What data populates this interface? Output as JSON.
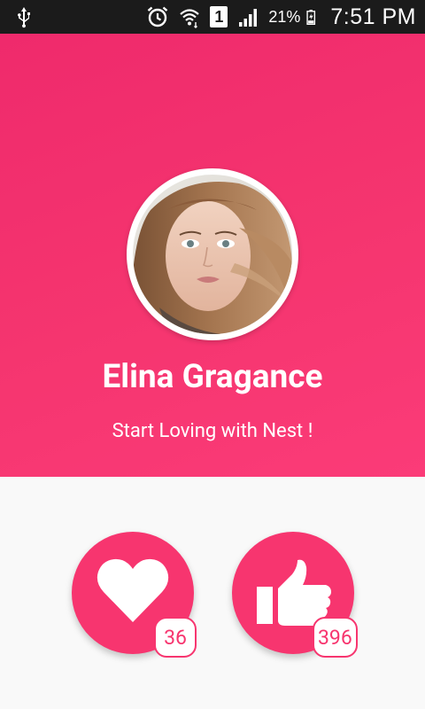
{
  "status_bar": {
    "battery_percent": "21%",
    "time": "7:51 PM",
    "sim_label": "1",
    "icons": [
      "usb-icon",
      "alarm-icon",
      "wifi-icon",
      "sim-icon",
      "signal-icon",
      "battery-icon"
    ]
  },
  "profile": {
    "name": "Elina Gragance",
    "tagline": "Start Loving with Nest !",
    "avatar_icon": "profile-photo"
  },
  "actions": {
    "love": {
      "icon": "heart-icon",
      "count": "36"
    },
    "like": {
      "icon": "thumbs-up-icon",
      "count": "396"
    }
  },
  "colors": {
    "accent": "#f7356f",
    "header_gradient_start": "#ef2a6c",
    "header_gradient_end": "#fb3b78",
    "status_bar": "#1b1b1b",
    "background": "#f9f9f9"
  }
}
